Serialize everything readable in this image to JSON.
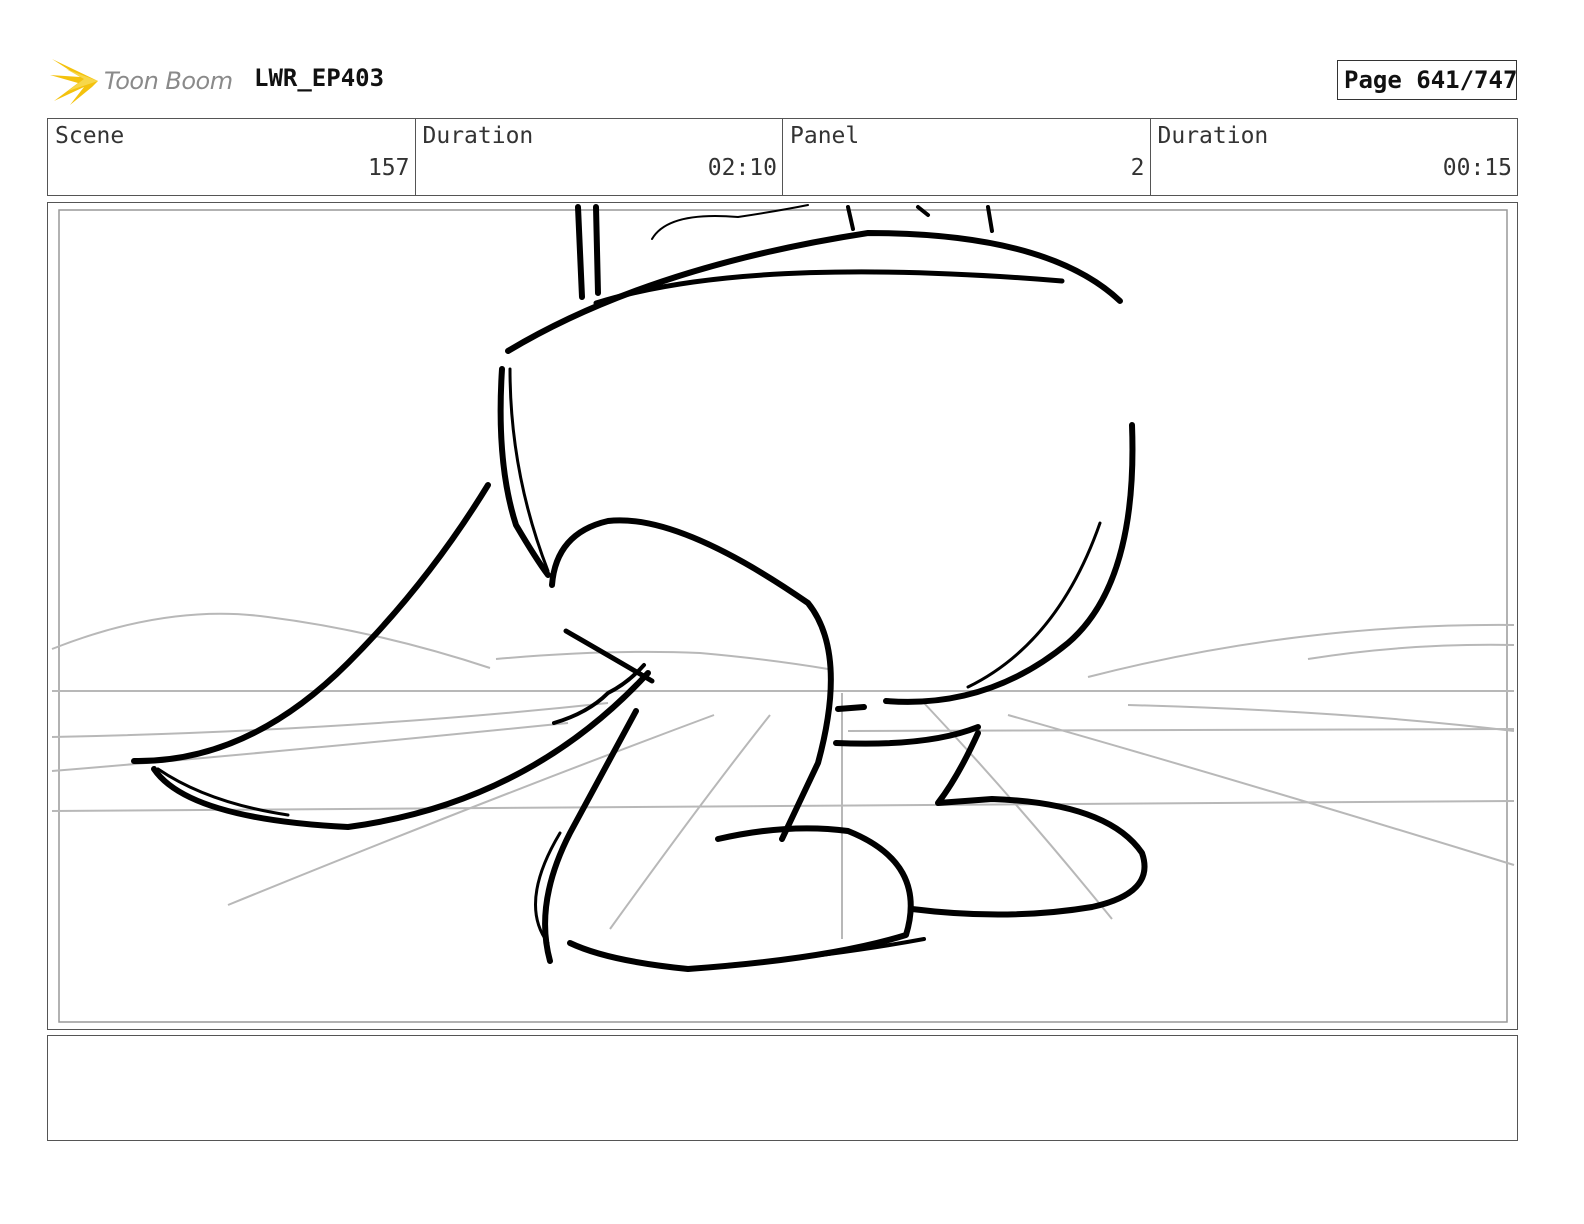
{
  "header": {
    "logo_text": "Toon Boom",
    "project": "LWR_EP403",
    "page_label": "Page 641/747"
  },
  "info": {
    "scene_label": "Scene",
    "scene_value": "157",
    "duration_label": "Duration",
    "duration_value": "02:10",
    "panel_label": "Panel",
    "panel_value": "2",
    "panel_duration_label": "Duration",
    "panel_duration_value": "00:15"
  },
  "notes": {
    "text": ""
  },
  "colors": {
    "logo_accent": "#f4c20d",
    "border": "#555555",
    "ink": "#000000",
    "guide": "#b3b3b3"
  }
}
